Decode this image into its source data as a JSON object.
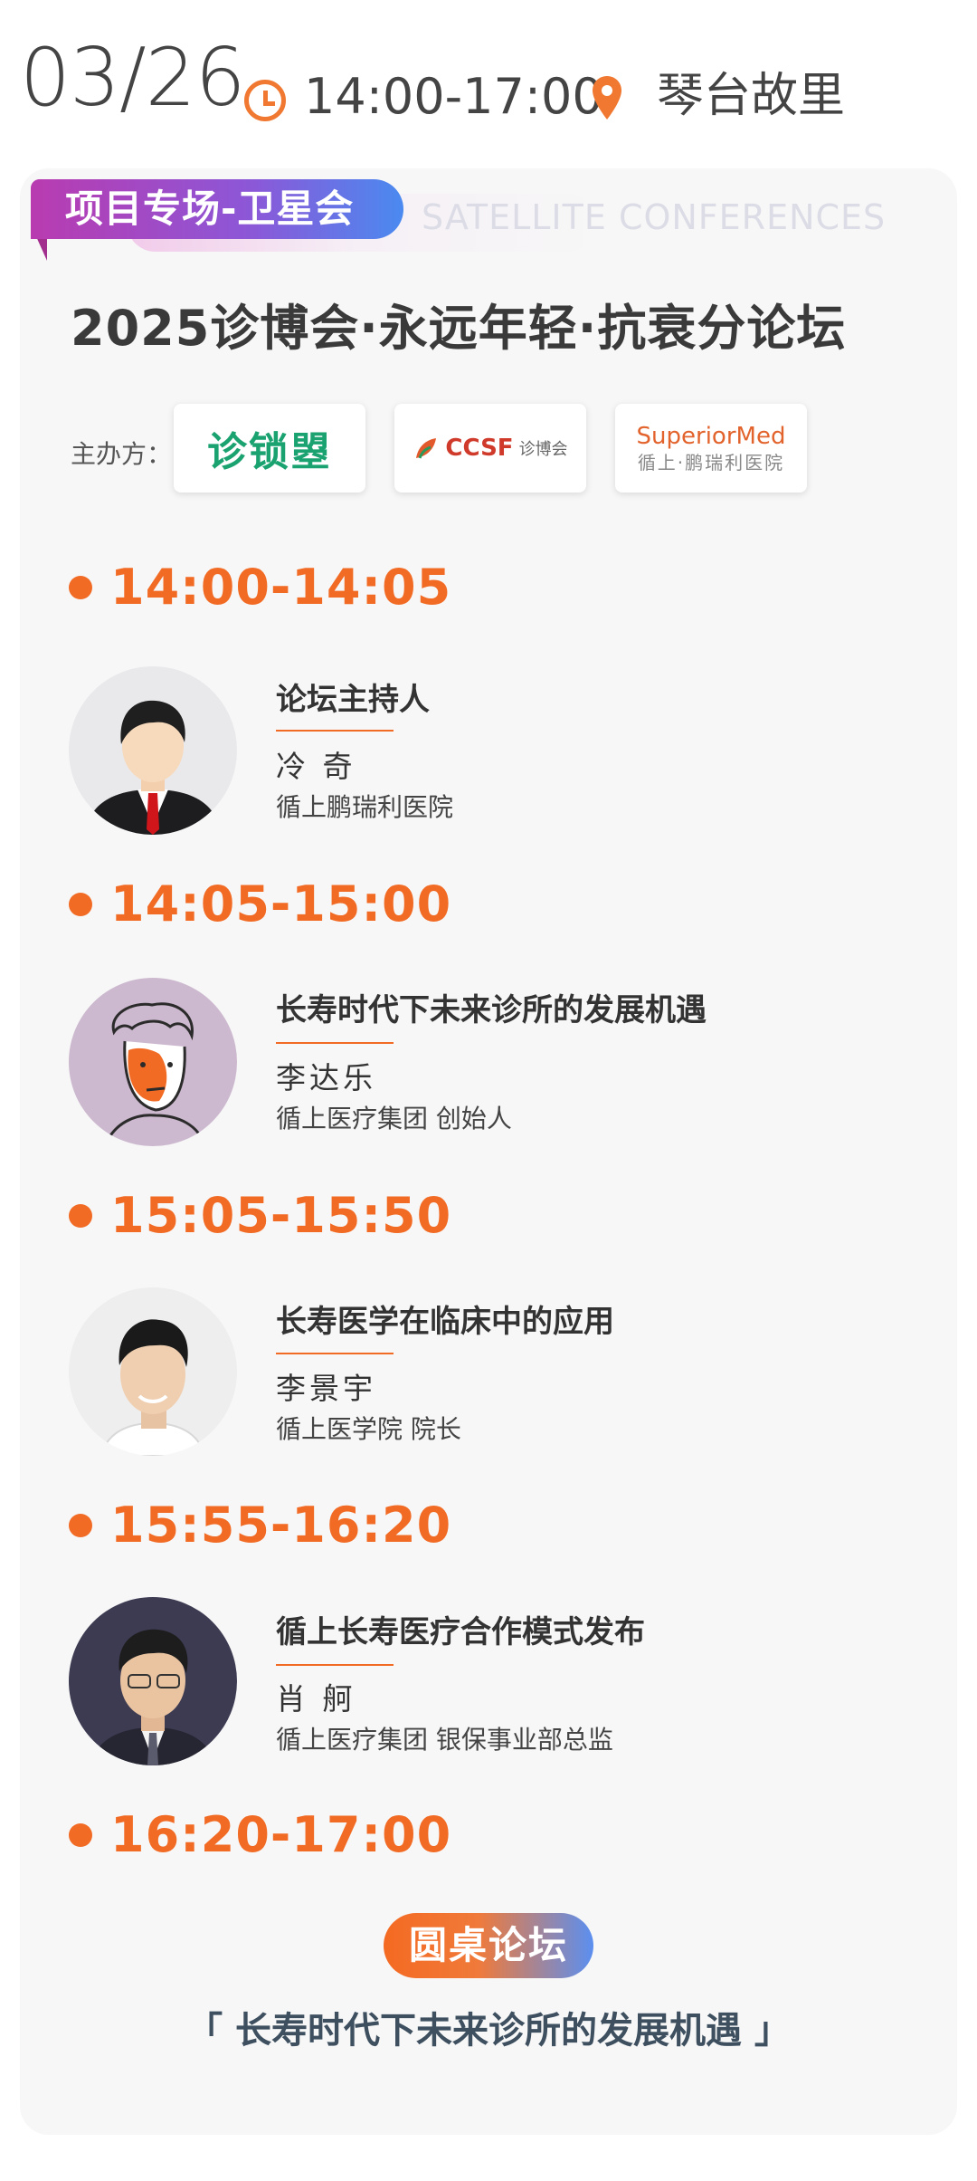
{
  "header": {
    "date": "03/26",
    "time": "14:00-17:00",
    "location": "琴台故里",
    "accent_color": "#f07830"
  },
  "card": {
    "tag": "项目专场-卫星会",
    "tag_en": "SATELLITE CONFERENCES",
    "title": "2025诊博会·永远年轻·抗衰分论坛",
    "organizer_label": "主办方：",
    "organizers": [
      {
        "name": "诊锁曌"
      },
      {
        "name": "CCSF",
        "subtitle": "诊博会"
      },
      {
        "name": "SuperiorMed",
        "subtitle": "循上·鹏瑞利医院"
      }
    ]
  },
  "schedule": [
    {
      "time": "14:00-14:05",
      "title": "论坛主持人",
      "speaker": "冷 奇",
      "org": "循上鹏瑞利医院"
    },
    {
      "time": "14:05-15:00",
      "title": "长寿时代下未来诊所的发展机遇",
      "speaker": "李达乐",
      "org": "循上医疗集团 创始人"
    },
    {
      "time": "15:05-15:50",
      "title": "长寿医学在临床中的应用",
      "speaker": "李景宇",
      "org": "循上医学院 院长"
    },
    {
      "time": "15:55-16:20",
      "title": "循上长寿医疗合作模式发布",
      "speaker": "肖 舸",
      "org": "循上医疗集团 银保事业部总监"
    },
    {
      "time": "16:20-17:00",
      "badge": "圆桌论坛",
      "topic": "「 长寿时代下未来诊所的发展机遇 」"
    }
  ],
  "colors": {
    "orange": "#f26b25",
    "tag_gradient_start": "#b93bb0",
    "tag_gradient_end": "#4a8af0",
    "card_bg": "#f7f7f7"
  }
}
